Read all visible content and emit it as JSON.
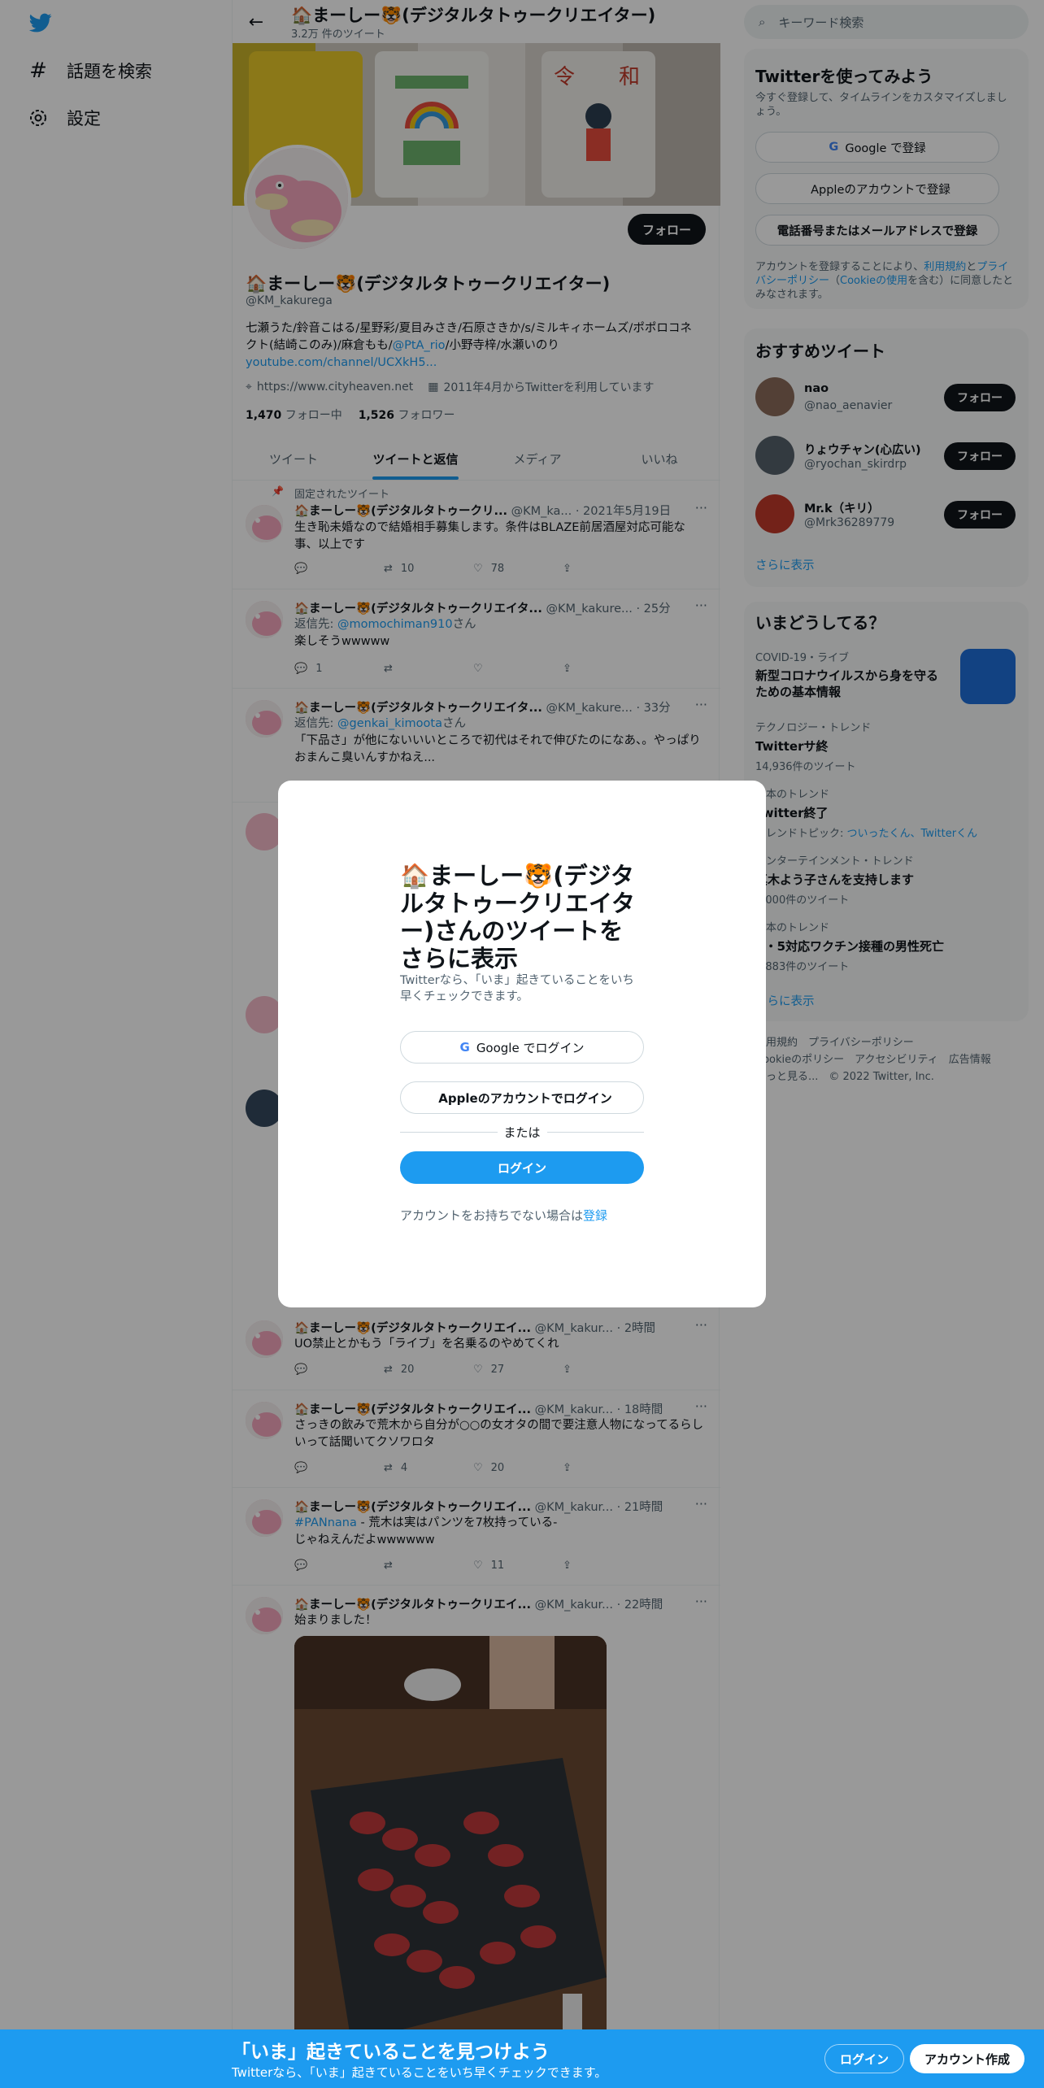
{
  "nav": {
    "explore": "話題を検索",
    "settings": "設定"
  },
  "topbar": {
    "name": "🏠まーしー🐯(デジタルタトゥークリエイター)",
    "count": "3.2万 件のツイート"
  },
  "profile": {
    "name": "🏠まーしー🐯(デジタルタトゥークリエイター)",
    "handle": "@KM_kakurega",
    "follow": "フォロー",
    "bio_line1": "七瀬うた/鈴音こはる/星野彩/夏目みさき/石原さきか/s/ミルキィホームズ/ポポロコネ",
    "bio_line2_pre": "クト(結崎このみ)/麻倉もも/",
    "bio_mention": "@PtA_rio",
    "bio_line2_post": "/小野寺梓/水瀬いのり",
    "bio_link": "youtube.com/channel/UCXkH5...",
    "website": "https://www.cityheaven.net",
    "joined": "2011年4月からTwitterを利用しています",
    "following_n": "1,470",
    "following_l": "フォロー中",
    "followers_n": "1,526",
    "followers_l": "フォロワー"
  },
  "tabs": [
    "ツイート",
    "ツイートと返信",
    "メディア",
    "いいね"
  ],
  "pinned_label": "固定されたツイート",
  "tweets": [
    {
      "name": "🏠まーしー🐯(デジタルタトゥークリ...",
      "meta": "@KM_ka... · 2021年5月19日",
      "text": "生き恥未婚なので結婚相手募集します。条件はBLAZE前居酒屋対応可能な事、以上です",
      "reply": "",
      "rt": "10",
      "like": "78"
    },
    {
      "name": "🏠まーしー🐯(デジタルタトゥークリエイタ...",
      "meta": "@KM_kakure... · 25分",
      "reply_to": "返信先:",
      "reply_user": "@momochiman910",
      "reply_san": "さん",
      "text": "楽しそうwwwww",
      "reply": "1",
      "rt": "",
      "like": ""
    },
    {
      "name": "🏠まーしー🐯(デジタルタトゥークリエイタ...",
      "meta": "@KM_kakure... · 33分",
      "reply_to": "返信先:",
      "reply_user": "@genkai_kimoota",
      "reply_san": "さん",
      "text": "「下品さ」が他にないいいところで初代はそれで伸びたのになあ、。やっぱりおまんこ臭いんすかねえ...",
      "reply": "",
      "rt": "",
      "like": ""
    },
    {
      "name": "🏠まーしー🐯(デジタルタトゥークリエイ...",
      "meta": "@KM_kakur... · 2時間",
      "text": "UO禁止とかもう「ライブ」を名乗るのやめてくれ",
      "reply": "",
      "rt": "20",
      "like": "27"
    },
    {
      "name": "🏠まーしー🐯(デジタルタトゥークリエイ...",
      "meta": "@KM_kakur... · 18時間",
      "text": "さっきの飲みで荒木から自分が○○の女オタの間で要注意人物になってるらしいって話聞いてクソワロタ",
      "reply": "",
      "rt": "4",
      "like": "20"
    },
    {
      "name": "🏠まーしー🐯(デジタルタトゥークリエイ...",
      "meta": "@KM_kakur... · 21時間",
      "hashtag": "#PANnana",
      "text": " - 荒木は実はパンツを7枚持っている-\nじゃねえんだよwwwwww",
      "reply": "",
      "rt": "",
      "like": "11"
    },
    {
      "name": "🏠まーしー🐯(デジタルタトゥークリエイ...",
      "meta": "@KM_kakur... · 22時間",
      "text": "始まりました！",
      "reply": "",
      "rt": "",
      "like": ""
    }
  ],
  "right": {
    "search_placeholder": "キーワード検索",
    "signup_title": "Twitterを使ってみよう",
    "signup_sub": "今すぐ登録して、タイムラインをカスタマイズしましょう。",
    "google_signup": "Google で登録",
    "apple_signup": "Appleのアカウントで登録",
    "phone_signup": "電話番号またはメールアドレスで登録",
    "terms_pre": "アカウントを登録することにより、",
    "terms_link1": "利用規約",
    "terms_mid": "と",
    "terms_link2": "プライバシーポリシー",
    "terms_paren_open": "（",
    "terms_link3": "Cookieの使用",
    "terms_post": "を含む）に同意したとみなされます。",
    "rec_title": "おすすめツイート",
    "recs": [
      {
        "name": "nao",
        "handle": "@nao_aenavier",
        "btn": "フォロー"
      },
      {
        "name": "りょウチャン(心広い)",
        "handle": "@ryochan_skirdrp",
        "btn": "フォロー"
      },
      {
        "name": "Mr.k（キリ）",
        "handle": "@Mrk36289779",
        "btn": "フォロー"
      }
    ],
    "show_more": "さらに表示",
    "trends_title": "いまどうしてる？",
    "trends": [
      {
        "cat": "COVID-19・ライブ",
        "title": "新型コロナウイルスから身を守るための基本情報",
        "sub": ""
      },
      {
        "cat": "テクノロジー・トレンド",
        "title": "Twitterサ終",
        "sub": "14,936件のツイート"
      },
      {
        "cat": "日本のトレンド",
        "title": "Twitter終了",
        "sub_pre": "トレンドトピック: ",
        "sub_links": "ついったくん、Twitterくん"
      },
      {
        "cat": "エンターテインメント・トレンド",
        "title": "真木よう子さんを支持します",
        "sub": "5,000件のツイート"
      },
      {
        "cat": "日本のトレンド",
        "title": "A・5対応ワクチン接種の男性死亡",
        "sub": "8,883件のツイート"
      }
    ],
    "trends_more": "さらに表示",
    "footer_line1": "利用規約　プライバシーポリシー",
    "footer_line2": "Cookieのポリシー　アクセシビリティ　広告情報",
    "footer_line3": "もっと見る...　© 2022 Twitter, Inc."
  },
  "modal": {
    "title": "🏠まーしー🐯(デジタルタトゥークリエイター)さんのツイートをさらに表示",
    "sub": "Twitterなら、「いま」起きていることをいち早くチェックできます。",
    "google": "Google でログイン",
    "apple": "Appleのアカウントでログイン",
    "or": "または",
    "login": "ログイン",
    "no_account": "アカウントをお持ちでない場合は",
    "signup": "登録"
  },
  "bottom": {
    "title": "「いま」起きていることを見つけよう",
    "sub": "Twitterなら、「いま」起きていることをいち早くチェックできます。",
    "login": "ログイン",
    "signup": "アカウント作成"
  },
  "colors": {
    "accent": "#1d9bf0",
    "text": "#0f1419",
    "muted": "#536471"
  }
}
